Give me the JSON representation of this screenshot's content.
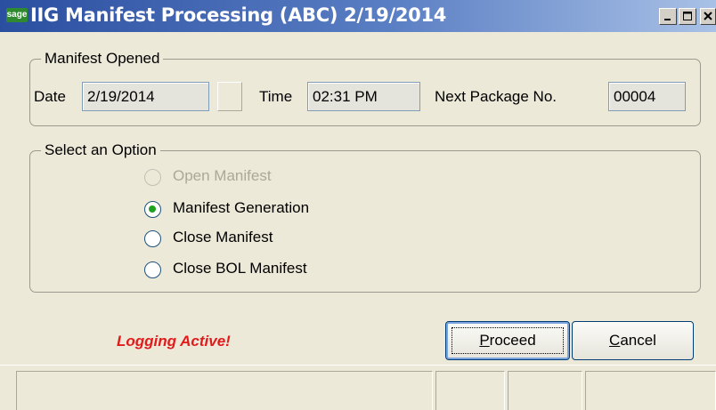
{
  "window": {
    "logo_text": "sage",
    "title": "IIG Manifest Processing (ABC) 2/19/2014",
    "controls": [
      "minimize",
      "maximize",
      "close"
    ]
  },
  "manifest_opened": {
    "legend": "Manifest Opened",
    "date_label": "Date",
    "date_value": "2/19/2014",
    "time_label": "Time",
    "time_value": "02:31 PM",
    "next_package_label": "Next Package No.",
    "next_package_value": "00004"
  },
  "select_option": {
    "legend": "Select an Option",
    "options": [
      {
        "label": "Open Manifest",
        "selected": false,
        "enabled": false
      },
      {
        "label": "Manifest Generation",
        "selected": true,
        "enabled": true
      },
      {
        "label": "Close Manifest",
        "selected": false,
        "enabled": true
      },
      {
        "label": "Close BOL Manifest",
        "selected": false,
        "enabled": true
      }
    ]
  },
  "status_text": "Logging Active!",
  "buttons": {
    "proceed_label": "Proceed",
    "proceed_accel": "P",
    "proceed_rest": "roceed",
    "cancel_label": "Cancel",
    "cancel_accel": "C",
    "cancel_rest": "ancel"
  },
  "colors": {
    "title_bar_start": "#2b4fa0",
    "title_bar_end": "#a9c1e6",
    "logging_text": "#e11b1b",
    "radio_selected": "#21a121",
    "window_bg": "#ece9d8"
  }
}
